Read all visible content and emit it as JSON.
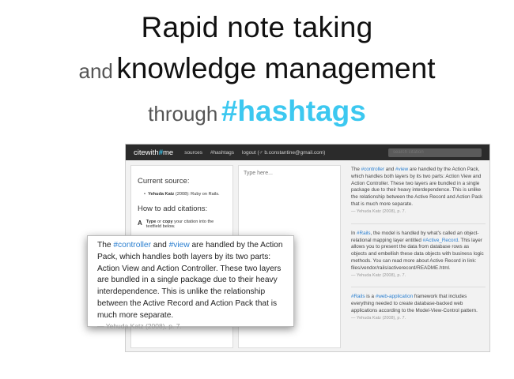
{
  "headline": {
    "line1": "Rapid note taking",
    "line2_small": "and",
    "line2_big": "knowledge management",
    "line3_small": "through",
    "line3_tag": "#hashtags"
  },
  "navbar": {
    "brand_pre": "citewith",
    "brand_hash": "#",
    "brand_post": "me",
    "links": [
      "sources",
      "#hashtags",
      "logout (♂ b.constantine@gmail.com)"
    ],
    "search_placeholder": "search citation"
  },
  "left_panel": {
    "current_source_title": "Current source:",
    "source_author": "Yehuda Katz",
    "source_rest": "(2008): Ruby on Rails.",
    "how_to_title": "How to add citations:",
    "step_letter": "A",
    "step_bold": "Type",
    "step_mid": "or",
    "step_bold2": "copy",
    "step_rest": "your citation into the textfield below."
  },
  "editor": {
    "placeholder": "Type here..."
  },
  "citations": [
    {
      "t1": "The ",
      "tag1": "#controller",
      "t2": " and ",
      "tag2": "#view",
      "t3": " are handled by the Action Pack, which handles both layers by its two parts: Action View and Action Controller. These two layers are bundled in a single package due to their heavy interdependence. This is unlike the relationship between the Active Record and Action Pack that is much more separate.",
      "by": "— Yehuda Katz (2008), p. 7."
    },
    {
      "t1": "In ",
      "tag1": "#Rails",
      "t2": ", the model is handled by what's called an object-relational mapping layer entitled ",
      "tag2": "#Active_Record",
      "t3": ". This layer allows you to present the data from database rows as objects and embellish these data objects with business logic methods. You can read more about Active Record in link: files/vendor/rails/activerecord/README.html.",
      "by": "— Yehuda Katz (2008), p. 7."
    },
    {
      "t1": "",
      "tag1": "#Rails",
      "t2": " is a ",
      "tag2": "#web-application",
      "t3": " framework that includes everything needed to create database-backed web applications according to the Model-View-Control pattern.",
      "by": "— Yehuda Katz (2008), p. 7."
    }
  ],
  "zoom": {
    "t1": "The ",
    "tag1": "#controller",
    "t2": " and ",
    "tag2": "#view",
    "t3": " are handled by the Action Pack, which handles both layers by its two parts: Action View and Action Controller. These two layers are bundled in a single package due to their heavy interdependence. This is unlike the relationship between the Active Record and Action Pack that is much more separate.",
    "by": "— Yehuda Katz (2008), p. 7."
  },
  "colors": {
    "accent": "#3cc8f0",
    "link": "#2a7fd0",
    "navbar": "#2b2b2b"
  }
}
